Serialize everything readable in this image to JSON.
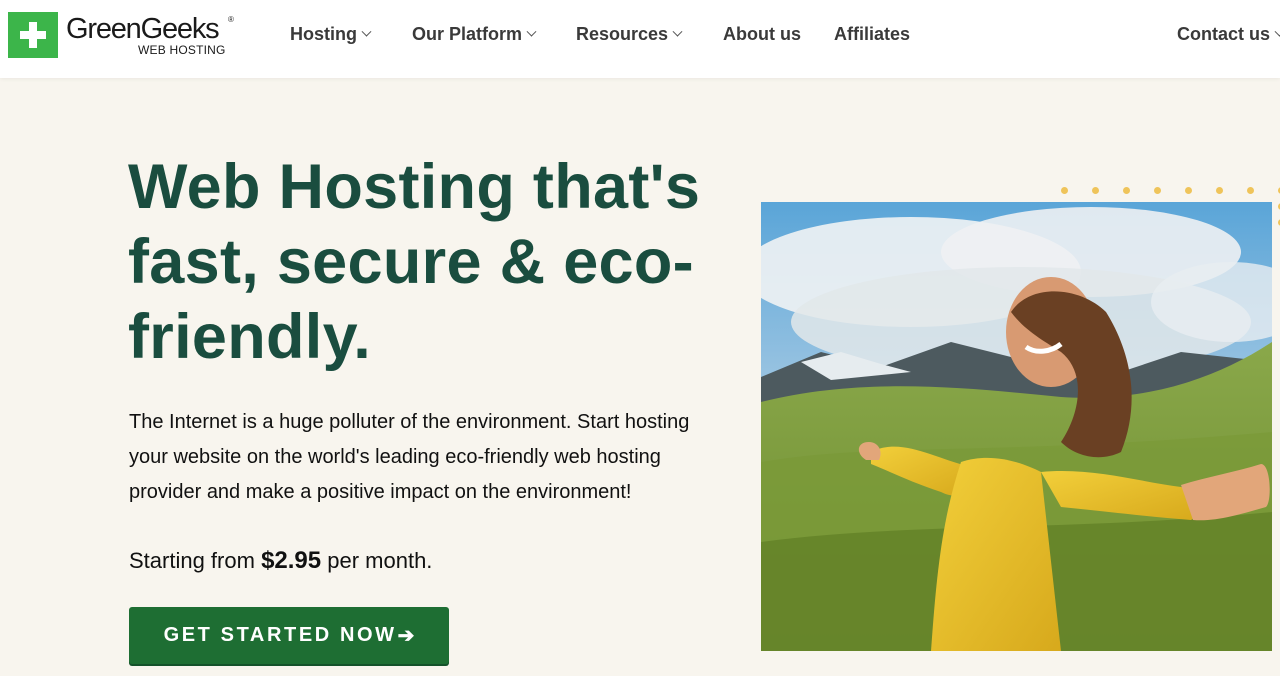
{
  "header": {
    "logo": {
      "name": "GreenGeeks",
      "registered": "®",
      "subtitle": "WEB HOSTING"
    },
    "nav": [
      {
        "label": "Hosting",
        "has_dropdown": true
      },
      {
        "label": "Our Platform",
        "has_dropdown": true
      },
      {
        "label": "Resources",
        "has_dropdown": true
      },
      {
        "label": "About us",
        "has_dropdown": false
      },
      {
        "label": "Affiliates",
        "has_dropdown": false
      },
      {
        "label": "Contact us",
        "has_dropdown": true
      }
    ]
  },
  "hero": {
    "title": "Web Hosting that's fast, secure & eco-friendly.",
    "description": "The Internet is a huge polluter of the environment. Start hosting your website on the world's leading eco-friendly web hosting provider and make a positive impact on the environment!",
    "price_prefix": "Starting from",
    "price": "$2.95",
    "price_suffix": "per month.",
    "cta_label": "GET STARTED NOW",
    "cta_icon": "arrow-right-icon"
  },
  "colors": {
    "brand_green": "#3cb54a",
    "heading_green": "#1a4d3f",
    "cta_green": "#1e6e33",
    "background": "#f8f5ee",
    "dot_yellow": "#efc45a"
  }
}
